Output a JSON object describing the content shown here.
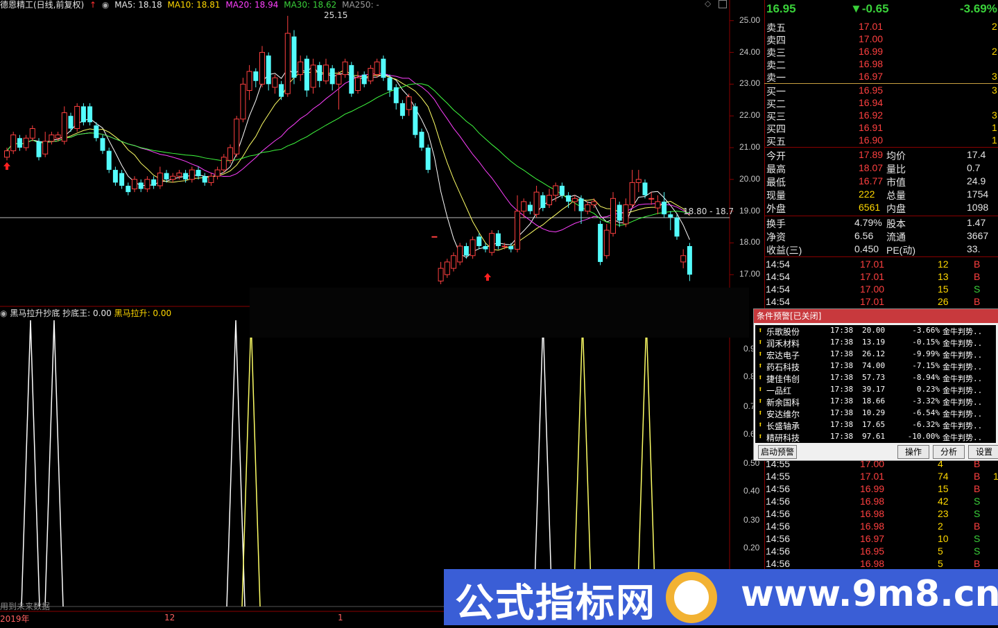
{
  "main_header": {
    "stock_name": "德恩精工(日线,前复权)",
    "ma5": "MA5: 18.18",
    "ma10": "MA10: 18.81",
    "ma20": "MA20: 18.94",
    "ma30": "MA30: 18.62",
    "ma250": "MA250: -",
    "high_label": "25.15",
    "crosshair_label": "18.80 - 18.7"
  },
  "price_axis": [
    "25.00",
    "24.00",
    "23.00",
    "22.00",
    "21.00",
    "20.00",
    "19.00",
    "18.00",
    "17.00"
  ],
  "indicator_header": {
    "name": "黑马拉升抄底",
    "bottom": "抄底王: 0.00",
    "rise": "黑马拉升: 0.00"
  },
  "indicator_axis": [
    "0.9",
    "0.8",
    "0.7",
    "0.6",
    "0.50",
    "0.40",
    "0.30",
    "0.20"
  ],
  "footer": {
    "future_note": "用到未来数据",
    "year": "2019年",
    "m12": "12",
    "m1": "1"
  },
  "quote": {
    "price": "16.95",
    "change": "▼-0.65",
    "pct": "-3.69%",
    "asks": [
      {
        "label": "卖五",
        "price": "17.01",
        "vol": "2"
      },
      {
        "label": "卖四",
        "price": "17.00",
        "vol": ""
      },
      {
        "label": "卖三",
        "price": "16.99",
        "vol": "2"
      },
      {
        "label": "卖二",
        "price": "16.98",
        "vol": ""
      },
      {
        "label": "卖一",
        "price": "16.97",
        "vol": "3"
      }
    ],
    "bids": [
      {
        "label": "买一",
        "price": "16.95",
        "vol": "3"
      },
      {
        "label": "买二",
        "price": "16.94",
        "vol": ""
      },
      {
        "label": "买三",
        "price": "16.92",
        "vol": "3"
      },
      {
        "label": "买四",
        "price": "16.91",
        "vol": "1"
      },
      {
        "label": "买五",
        "price": "16.90",
        "vol": "1"
      }
    ],
    "stats": [
      {
        "l1": "今开",
        "v1": "17.89",
        "l2": "均价",
        "v2": "17.4"
      },
      {
        "l1": "最高",
        "v1": "18.07",
        "l2": "量比",
        "v2": "0.7"
      },
      {
        "l1": "最低",
        "v1": "16.77",
        "l2": "市值",
        "v2": "24.9"
      },
      {
        "l1": "现量",
        "v1": "222",
        "l2": "总量",
        "v2": "1754"
      },
      {
        "l1": "外盘",
        "v1": "6561",
        "l2": "内盘",
        "v2": "1098"
      }
    ],
    "stats2": [
      {
        "l1": "换手",
        "v1": "4.79%",
        "l2": "股本",
        "v2": "1.47"
      },
      {
        "l1": "净资",
        "v1": "6.56",
        "l2": "流通",
        "v2": "3667"
      },
      {
        "l1": "收益(三)",
        "v1": "0.450",
        "l2": "PE(动)",
        "v2": "33."
      }
    ],
    "ticks_top": [
      {
        "t": "14:54",
        "p": "17.01",
        "v": "12",
        "s": "B"
      },
      {
        "t": "14:54",
        "p": "17.01",
        "v": "13",
        "s": "B"
      },
      {
        "t": "14:54",
        "p": "17.00",
        "v": "15",
        "s": "S"
      },
      {
        "t": "14:54",
        "p": "17.01",
        "v": "26",
        "s": "B"
      }
    ],
    "ticks_bottom": [
      {
        "t": "14:55",
        "p": "17.00",
        "v": "4",
        "s": "B"
      },
      {
        "t": "14:55",
        "p": "17.01",
        "v": "74",
        "s": "B",
        "x": "1"
      },
      {
        "t": "14:56",
        "p": "16.99",
        "v": "15",
        "s": "B"
      },
      {
        "t": "14:56",
        "p": "16.98",
        "v": "42",
        "s": "S"
      },
      {
        "t": "14:56",
        "p": "16.98",
        "v": "23",
        "s": "S"
      },
      {
        "t": "14:56",
        "p": "16.98",
        "v": "2",
        "s": "B"
      },
      {
        "t": "14:56",
        "p": "16.97",
        "v": "10",
        "s": "S"
      },
      {
        "t": "14:56",
        "p": "16.95",
        "v": "5",
        "s": "S"
      },
      {
        "t": "14:56",
        "p": "16.98",
        "v": "5",
        "s": "B"
      }
    ]
  },
  "alert": {
    "title": "条件预警[已关闭]",
    "rows": [
      {
        "name": "乐歌股份",
        "time": "17:38",
        "price": "20.00",
        "pct": "-3.66%",
        "cond": "金牛判势.."
      },
      {
        "name": "润禾材料",
        "time": "17:38",
        "price": "13.19",
        "pct": "-0.15%",
        "cond": "金牛判势.."
      },
      {
        "name": "宏达电子",
        "time": "17:38",
        "price": "26.12",
        "pct": "-9.99%",
        "cond": "金牛判势.."
      },
      {
        "name": "药石科技",
        "time": "17:38",
        "price": "74.00",
        "pct": "-7.15%",
        "cond": "金牛判势.."
      },
      {
        "name": "捷佳伟创",
        "time": "17:38",
        "price": "57.73",
        "pct": "-8.94%",
        "cond": "金牛判势.."
      },
      {
        "name": "一品红",
        "time": "17:38",
        "price": "39.17",
        "pct": "0.23%",
        "cond": "金牛判势.."
      },
      {
        "name": "新余国科",
        "time": "17:38",
        "price": "18.66",
        "pct": "-3.32%",
        "cond": "金牛判势.."
      },
      {
        "name": "安达维尔",
        "time": "17:38",
        "price": "10.29",
        "pct": "-6.54%",
        "cond": "金牛判势.."
      },
      {
        "name": "长盛轴承",
        "time": "17:38",
        "price": "17.65",
        "pct": "-6.32%",
        "cond": "金牛判势.."
      },
      {
        "name": "精研科技",
        "time": "17:38",
        "price": "97.61",
        "pct": "-10.00%",
        "cond": "金牛判势.."
      }
    ],
    "btn_start": "启动预警",
    "btn_op": "操作",
    "btn_analyze": "分析",
    "btn_settings": "设置"
  },
  "watermark": {
    "text": "公式指标网",
    "url": "www.9m8.cn"
  },
  "colors": {
    "up": "#ff4040",
    "down": "#54fcfc",
    "ma5": "#ffffff",
    "ma10": "#ffff66",
    "ma20": "#ff40ff",
    "ma30": "#40ff40"
  },
  "chart_data": {
    "type": "candlestick",
    "ylim": [
      16.7,
      25.3
    ],
    "candles": [
      {
        "o": 20.7,
        "c": 20.9,
        "h": 21.0,
        "l": 20.6
      },
      {
        "o": 20.9,
        "c": 21.4,
        "h": 21.5,
        "l": 20.8
      },
      {
        "o": 21.3,
        "c": 21.0,
        "h": 21.4,
        "l": 20.9
      },
      {
        "o": 21.0,
        "c": 21.3,
        "h": 21.4,
        "l": 20.9
      },
      {
        "o": 21.3,
        "c": 21.6,
        "h": 21.7,
        "l": 21.2
      },
      {
        "o": 21.2,
        "c": 20.7,
        "h": 21.3,
        "l": 20.6
      },
      {
        "o": 20.8,
        "c": 21.2,
        "h": 21.5,
        "l": 20.7
      },
      {
        "o": 21.2,
        "c": 21.4,
        "h": 21.5,
        "l": 21.1
      },
      {
        "o": 21.3,
        "c": 21.4,
        "h": 21.5,
        "l": 21.2
      },
      {
        "o": 21.2,
        "c": 22.1,
        "h": 22.3,
        "l": 21.1
      },
      {
        "o": 22.0,
        "c": 21.6,
        "h": 22.1,
        "l": 21.5
      },
      {
        "o": 21.6,
        "c": 22.3,
        "h": 22.4,
        "l": 21.5
      },
      {
        "o": 22.3,
        "c": 21.8,
        "h": 22.4,
        "l": 21.7
      },
      {
        "o": 22.3,
        "c": 21.8,
        "h": 22.4,
        "l": 21.7
      },
      {
        "o": 21.7,
        "c": 21.3,
        "h": 21.8,
        "l": 21.2
      },
      {
        "o": 21.3,
        "c": 20.9,
        "h": 21.4,
        "l": 20.8
      },
      {
        "o": 20.9,
        "c": 20.3,
        "h": 21.0,
        "l": 20.2
      },
      {
        "o": 20.3,
        "c": 19.9,
        "h": 20.4,
        "l": 19.8
      },
      {
        "o": 20.2,
        "c": 19.8,
        "h": 20.3,
        "l": 19.7
      },
      {
        "o": 19.8,
        "c": 19.6,
        "h": 19.9,
        "l": 19.5
      },
      {
        "o": 19.7,
        "c": 20.0,
        "h": 20.1,
        "l": 19.6
      },
      {
        "o": 19.9,
        "c": 19.7,
        "h": 20.0,
        "l": 19.6
      },
      {
        "o": 19.7,
        "c": 20.0,
        "h": 20.1,
        "l": 19.6
      },
      {
        "o": 20.0,
        "c": 19.8,
        "h": 20.1,
        "l": 19.7
      },
      {
        "o": 19.8,
        "c": 20.2,
        "h": 20.4,
        "l": 19.7
      },
      {
        "o": 20.2,
        "c": 20.0,
        "h": 20.3,
        "l": 19.9
      },
      {
        "o": 20.0,
        "c": 20.1,
        "h": 20.2,
        "l": 19.9
      },
      {
        "o": 20.1,
        "c": 20.2,
        "h": 20.3,
        "l": 20.0
      },
      {
        "o": 20.2,
        "c": 20.0,
        "h": 20.3,
        "l": 19.9
      },
      {
        "o": 20.0,
        "c": 20.3,
        "h": 20.4,
        "l": 19.9
      },
      {
        "o": 20.3,
        "c": 20.1,
        "h": 20.4,
        "l": 20.0
      },
      {
        "o": 20.1,
        "c": 19.9,
        "h": 20.2,
        "l": 19.8
      },
      {
        "o": 19.9,
        "c": 20.1,
        "h": 20.2,
        "l": 19.8
      },
      {
        "o": 20.1,
        "c": 20.3,
        "h": 20.4,
        "l": 20.0
      },
      {
        "o": 20.3,
        "c": 20.7,
        "h": 20.8,
        "l": 20.2
      },
      {
        "o": 20.6,
        "c": 21.0,
        "h": 21.1,
        "l": 20.5
      },
      {
        "o": 20.8,
        "c": 21.9,
        "h": 22.0,
        "l": 20.7
      },
      {
        "o": 21.9,
        "c": 23.0,
        "h": 23.2,
        "l": 21.8
      },
      {
        "o": 22.8,
        "c": 23.4,
        "h": 23.6,
        "l": 22.5
      },
      {
        "o": 23.4,
        "c": 23.1,
        "h": 23.5,
        "l": 22.9
      },
      {
        "o": 23.0,
        "c": 24.0,
        "h": 24.2,
        "l": 22.9
      },
      {
        "o": 23.9,
        "c": 23.0,
        "h": 24.0,
        "l": 22.8
      },
      {
        "o": 22.9,
        "c": 23.2,
        "h": 23.3,
        "l": 22.7
      },
      {
        "o": 23.0,
        "c": 22.6,
        "h": 23.1,
        "l": 22.5
      },
      {
        "o": 22.7,
        "c": 24.6,
        "h": 25.15,
        "l": 22.6
      },
      {
        "o": 24.5,
        "c": 23.2,
        "h": 24.7,
        "l": 23.0
      },
      {
        "o": 23.3,
        "c": 23.7,
        "h": 23.9,
        "l": 23.1
      },
      {
        "o": 23.8,
        "c": 22.8,
        "h": 23.9,
        "l": 22.6
      },
      {
        "o": 22.9,
        "c": 23.6,
        "h": 23.8,
        "l": 22.7
      },
      {
        "o": 23.6,
        "c": 23.1,
        "h": 23.7,
        "l": 22.9
      },
      {
        "o": 23.1,
        "c": 23.6,
        "h": 23.8,
        "l": 23.0
      },
      {
        "o": 23.5,
        "c": 23.0,
        "h": 23.6,
        "l": 22.8
      },
      {
        "o": 23.0,
        "c": 23.3,
        "h": 23.4,
        "l": 22.2
      },
      {
        "o": 23.3,
        "c": 23.7,
        "h": 23.8,
        "l": 23.2
      },
      {
        "o": 23.6,
        "c": 22.7,
        "h": 23.7,
        "l": 22.6
      },
      {
        "o": 22.8,
        "c": 23.2,
        "h": 23.4,
        "l": 22.7
      },
      {
        "o": 23.3,
        "c": 23.0,
        "h": 23.4,
        "l": 22.9
      },
      {
        "o": 23.1,
        "c": 23.5,
        "h": 23.6,
        "l": 23.0
      },
      {
        "o": 23.3,
        "c": 23.7,
        "h": 23.8,
        "l": 23.2
      },
      {
        "o": 23.8,
        "c": 23.2,
        "h": 23.9,
        "l": 23.1
      },
      {
        "o": 23.2,
        "c": 22.8,
        "h": 23.3,
        "l": 22.6
      },
      {
        "o": 22.9,
        "c": 22.4,
        "h": 23.0,
        "l": 22.2
      },
      {
        "o": 22.4,
        "c": 22.0,
        "h": 22.5,
        "l": 21.9
      },
      {
        "o": 22.2,
        "c": 22.6,
        "h": 22.7,
        "l": 22.0
      },
      {
        "o": 22.3,
        "c": 21.4,
        "h": 22.4,
        "l": 21.3
      },
      {
        "o": 21.5,
        "c": 21.0,
        "h": 21.6,
        "l": 20.9
      },
      {
        "o": 21.0,
        "c": 20.3,
        "h": 21.1,
        "l": 20.2
      },
      {
        "o": 18.2,
        "c": 18.2,
        "h": 18.2,
        "l": 18.2
      },
      {
        "o": 16.8,
        "c": 17.2,
        "h": 17.4,
        "l": 16.7
      },
      {
        "o": 17.0,
        "c": 17.4,
        "h": 17.5,
        "l": 16.9
      },
      {
        "o": 17.2,
        "c": 17.6,
        "h": 17.7,
        "l": 17.1
      },
      {
        "o": 17.4,
        "c": 17.9,
        "h": 18.0,
        "l": 17.3
      },
      {
        "o": 17.9,
        "c": 17.6,
        "h": 18.0,
        "l": 17.5
      },
      {
        "o": 17.6,
        "c": 18.1,
        "h": 18.2,
        "l": 17.5
      },
      {
        "o": 18.2,
        "c": 17.9,
        "h": 18.3,
        "l": 17.8
      },
      {
        "o": 17.9,
        "c": 17.8,
        "h": 18.0,
        "l": 17.7
      },
      {
        "o": 17.7,
        "c": 18.3,
        "h": 18.4,
        "l": 17.6
      },
      {
        "o": 18.3,
        "c": 17.9,
        "h": 18.4,
        "l": 17.8
      },
      {
        "o": 17.9,
        "c": 17.9,
        "h": 18.0,
        "l": 17.8
      },
      {
        "o": 17.9,
        "c": 17.8,
        "h": 18.0,
        "l": 17.7
      },
      {
        "o": 17.8,
        "c": 19.0,
        "h": 19.5,
        "l": 17.7
      },
      {
        "o": 19.0,
        "c": 19.3,
        "h": 19.4,
        "l": 18.8
      },
      {
        "o": 19.2,
        "c": 19.0,
        "h": 19.3,
        "l": 18.9
      },
      {
        "o": 18.9,
        "c": 19.6,
        "h": 19.8,
        "l": 18.8
      },
      {
        "o": 19.5,
        "c": 19.1,
        "h": 19.6,
        "l": 19.0
      },
      {
        "o": 19.2,
        "c": 19.5,
        "h": 19.7,
        "l": 19.1
      },
      {
        "o": 19.5,
        "c": 19.8,
        "h": 19.9,
        "l": 19.3
      },
      {
        "o": 19.8,
        "c": 19.5,
        "h": 19.9,
        "l": 19.4
      },
      {
        "o": 19.5,
        "c": 19.3,
        "h": 19.6,
        "l": 19.1
      },
      {
        "o": 19.3,
        "c": 19.4,
        "h": 19.5,
        "l": 19.0
      },
      {
        "o": 19.4,
        "c": 19.0,
        "h": 19.5,
        "l": 18.6
      },
      {
        "o": 19.0,
        "c": 19.2,
        "h": 19.3,
        "l": 18.9
      },
      {
        "o": 19.2,
        "c": 19.3,
        "h": 19.4,
        "l": 19.1
      },
      {
        "o": 18.6,
        "c": 17.4,
        "h": 18.7,
        "l": 17.3
      },
      {
        "o": 17.6,
        "c": 18.4,
        "h": 18.6,
        "l": 17.5
      },
      {
        "o": 18.3,
        "c": 19.4,
        "h": 19.6,
        "l": 18.2
      },
      {
        "o": 19.2,
        "c": 18.7,
        "h": 19.3,
        "l": 18.5
      },
      {
        "o": 18.6,
        "c": 19.2,
        "h": 19.4,
        "l": 18.5
      },
      {
        "o": 19.2,
        "c": 19.9,
        "h": 20.3,
        "l": 19.1
      },
      {
        "o": 19.9,
        "c": 20.0,
        "h": 20.3,
        "l": 19.6
      },
      {
        "o": 19.9,
        "c": 19.5,
        "h": 20.0,
        "l": 19.4
      },
      {
        "o": 19.4,
        "c": 19.4,
        "h": 19.6,
        "l": 19.2
      },
      {
        "o": 19.1,
        "c": 19.3,
        "h": 19.5,
        "l": 18.9
      },
      {
        "o": 19.3,
        "c": 18.9,
        "h": 19.6,
        "l": 18.8
      },
      {
        "o": 18.9,
        "c": 18.8,
        "h": 19.0,
        "l": 18.4
      },
      {
        "o": 18.8,
        "c": 18.2,
        "h": 18.9,
        "l": 18.1
      },
      {
        "o": 17.4,
        "c": 17.6,
        "h": 17.8,
        "l": 17.2
      },
      {
        "o": 17.9,
        "c": 17.0,
        "h": 18.0,
        "l": 16.8
      }
    ]
  }
}
